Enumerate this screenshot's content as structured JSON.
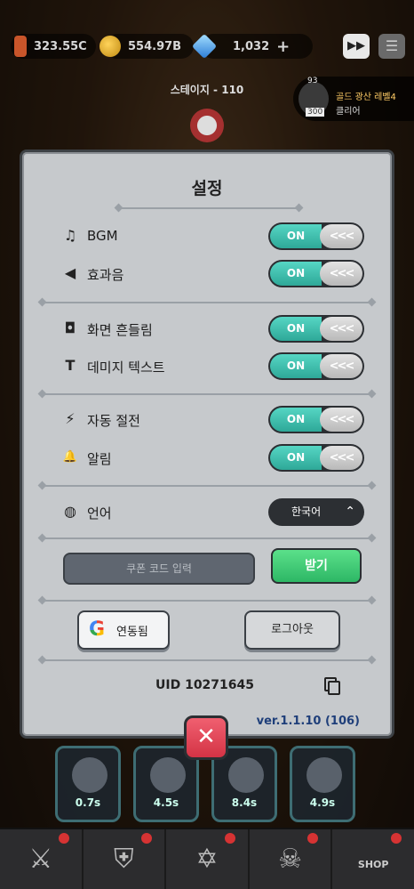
{
  "hud": {
    "attack_power": "323.55C",
    "gold": "554.97B",
    "gems": "1,032",
    "gem_add_symbol": "+",
    "fast_forward_symbol": "▶▶",
    "menu_symbol": "☰"
  },
  "stage": "스테이지 - 110",
  "quest": {
    "progress_top": "93",
    "progress_bottom": "300",
    "title": "골드 광산 레벨4",
    "subtitle": "클리어"
  },
  "settings": {
    "title": "설정",
    "rows": [
      {
        "icon": "music-note-icon",
        "glyph": "♫",
        "label": "BGM",
        "state": "ON"
      },
      {
        "icon": "speaker-icon",
        "glyph": "◀",
        "label": "효과음",
        "state": "ON"
      },
      {
        "icon": "camera-icon",
        "glyph": "◘",
        "label": "화면 흔들림",
        "state": "ON"
      },
      {
        "icon": "damage-text-icon",
        "glyph": "T",
        "label": "데미지 텍스트",
        "state": "ON"
      },
      {
        "icon": "lightning-icon",
        "glyph": "⚡",
        "label": "자동 절전",
        "state": "ON"
      },
      {
        "icon": "bell-icon",
        "glyph": "🔔",
        "label": "알림",
        "state": "ON"
      }
    ],
    "toggle_knob": "<<<",
    "language": {
      "label": "언어",
      "glyph": "◍",
      "value": "한국어",
      "chevron": "⌃"
    },
    "coupon_placeholder": "쿠폰 코드 입력",
    "redeem_label": "받기",
    "google_label": "연동됨",
    "google_glyph": "G",
    "logout_label": "로그아웃",
    "uid": "UID 10271645",
    "version": "ver.1.1.10 (106)",
    "close_symbol": "✕"
  },
  "heroes": [
    {
      "cooldown": "0.7s"
    },
    {
      "cooldown": "4.5s"
    },
    {
      "cooldown": "8.4s"
    },
    {
      "cooldown": "4.9s"
    }
  ],
  "nav": {
    "items": [
      {
        "icon": "sword-icon",
        "glyph": "⚔"
      },
      {
        "icon": "helmet-icon",
        "glyph": "⛨"
      },
      {
        "icon": "book-icon",
        "glyph": "✡"
      },
      {
        "icon": "skull-icon",
        "glyph": "☠"
      },
      {
        "icon": "shop-icon",
        "label": "SHOP"
      }
    ]
  }
}
